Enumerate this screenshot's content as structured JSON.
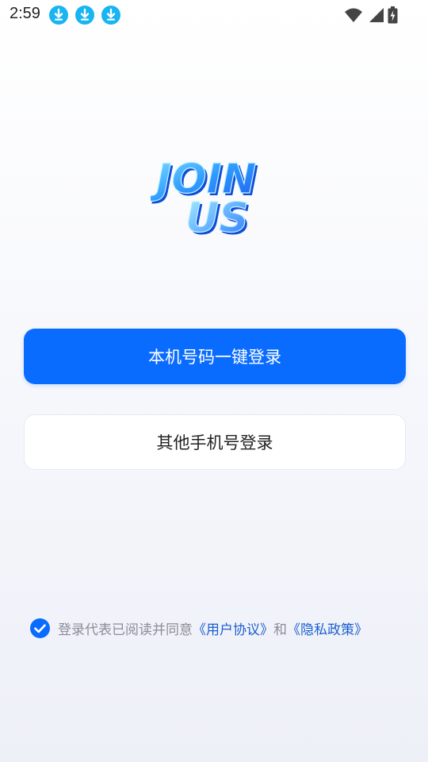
{
  "status_bar": {
    "time": "2:59",
    "notification_icons": [
      "download-icon",
      "download-icon",
      "download-icon"
    ],
    "system_icons": [
      "wifi-icon",
      "signal-icon",
      "battery-charging-icon"
    ]
  },
  "logo": {
    "line1": "JOIN",
    "line2": "US"
  },
  "buttons": {
    "one_click_login": "本机号码一键登录",
    "other_phone_login": "其他手机号登录"
  },
  "agreement": {
    "checked": true,
    "prefix": "登录代表已阅读并同意",
    "user_agreement": "《用户协议》",
    "and": "和",
    "privacy_policy": "《隐私政策》"
  },
  "colors": {
    "primary": "#0a6cff",
    "link": "#1a5fd0",
    "notification_icon": "#19b4f2"
  }
}
